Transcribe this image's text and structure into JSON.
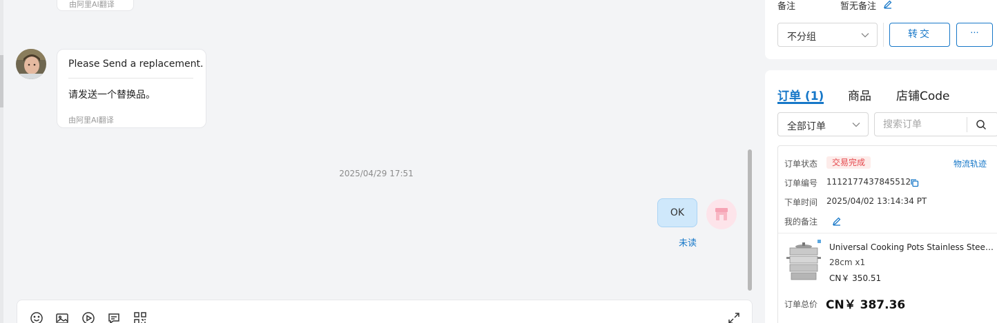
{
  "chat": {
    "prev_message_note": "由阿里AI翻译",
    "incoming_message": {
      "original_text": "Please Send a replacement.",
      "translated_text": "请发送一个替换品。",
      "translation_note": "由阿里AI翻译"
    },
    "timestamp": "2025/04/29 17:51",
    "outgoing_message": {
      "text": "OK",
      "read_status": "未读"
    },
    "composer_tools": [
      "emoji-icon",
      "image-icon",
      "video-icon",
      "quick-reply-icon",
      "qr-icon",
      "expand-icon"
    ]
  },
  "panel": {
    "remark_label": "备注",
    "remark_value": "暂无备注",
    "group_select_value": "不分组",
    "transfer_button": "转交",
    "more_button": "···",
    "tabs": [
      "订单 (1)",
      "商品",
      "店铺Code"
    ],
    "order_filter_value": "全部订单",
    "search_placeholder": "搜索订单",
    "order": {
      "status_label": "订单状态",
      "status_value": "交易完成",
      "logistics_link": "物流轨迹",
      "number_label": "订单编号",
      "number_value": "1112177437845512",
      "time_label": "下单时间",
      "time_value": "2025/04/02 13:14:34 PT",
      "my_remark_label": "我的备注",
      "product_title": "Universal Cooking Pots Stainless Steel Steamer",
      "product_variant": "28cm x1",
      "product_price": "CN￥ 350.51",
      "total_label": "订单总价",
      "total_value": "CN￥ 387.36"
    }
  },
  "colors": {
    "accent": "#1677c8",
    "status_red": "#e5484d",
    "outgoing_bubble": "#cfe8fb"
  }
}
